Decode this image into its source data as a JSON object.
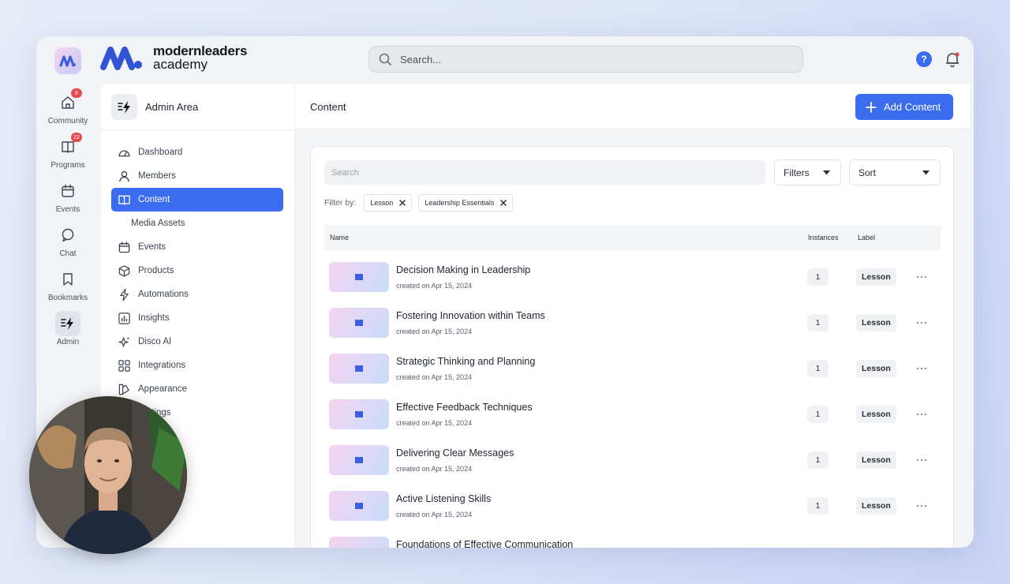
{
  "brand": {
    "line1": "modernleaders",
    "line2": "academy",
    "accent": "#3b6cf0"
  },
  "topbar": {
    "search_placeholder": "Search...",
    "help_label": "?"
  },
  "rail": [
    {
      "label": "Community",
      "icon": "community-icon",
      "badge": "6"
    },
    {
      "label": "Programs",
      "icon": "programs-icon",
      "badge": "22"
    },
    {
      "label": "Events",
      "icon": "calendar-icon",
      "badge": ""
    },
    {
      "label": "Chat",
      "icon": "chat-icon",
      "badge": ""
    },
    {
      "label": "Bookmarks",
      "icon": "bookmark-icon",
      "badge": ""
    },
    {
      "label": "Admin",
      "icon": "admin-icon",
      "badge": ""
    }
  ],
  "sidebar": {
    "title": "Admin Area",
    "items": [
      {
        "label": "Dashboard"
      },
      {
        "label": "Members"
      },
      {
        "label": "Content"
      },
      {
        "label": "Media Assets"
      },
      {
        "label": "Events"
      },
      {
        "label": "Products"
      },
      {
        "label": "Automations"
      },
      {
        "label": "Insights"
      },
      {
        "label": "Disco AI"
      },
      {
        "label": "Integrations"
      },
      {
        "label": "Appearance"
      },
      {
        "label": "Settings"
      }
    ]
  },
  "main": {
    "title": "Content",
    "add_button": "Add Content",
    "search_placeholder": "Search",
    "filters_label": "Filters",
    "sort_label": "Sort",
    "filter_by_label": "Filter by:",
    "chips": [
      "Lesson",
      "Leadership Essentials"
    ],
    "columns": {
      "name": "Name",
      "instances": "Instances",
      "label": "Label"
    },
    "rows": [
      {
        "title": "Decision Making in Leadership",
        "created": "created on Apr 15, 2024",
        "instances": "1",
        "label": "Lesson"
      },
      {
        "title": "Fostering Innovation within Teams",
        "created": "created on Apr 15, 2024",
        "instances": "1",
        "label": "Lesson"
      },
      {
        "title": "Strategic Thinking and Planning",
        "created": "created on Apr 15, 2024",
        "instances": "1",
        "label": "Lesson"
      },
      {
        "title": "Effective Feedback Techniques",
        "created": "created on Apr 15, 2024",
        "instances": "1",
        "label": "Lesson"
      },
      {
        "title": "Delivering Clear Messages",
        "created": "created on Apr 15, 2024",
        "instances": "1",
        "label": "Lesson"
      },
      {
        "title": "Active Listening Skills",
        "created": "created on Apr 15, 2024",
        "instances": "1",
        "label": "Lesson"
      },
      {
        "title": "Foundations of Effective Communication",
        "created": "",
        "instances": "",
        "label": ""
      }
    ]
  }
}
